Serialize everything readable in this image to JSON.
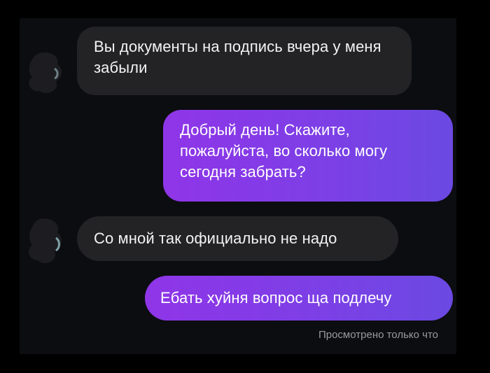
{
  "chat": {
    "messages": [
      {
        "direction": "incoming",
        "text": "Вы документы на подпись вчера у меня забыли"
      },
      {
        "direction": "outgoing",
        "text": "Добрый день! Скажите, пожалуйста, во сколько могу сегодня забрать?"
      },
      {
        "direction": "incoming",
        "text": "Со мной так официально не надо"
      },
      {
        "direction": "outgoing",
        "text": "Ебать хуйня вопрос ща подлечу"
      }
    ],
    "seen_status": "Просмотрено только что"
  },
  "colors": {
    "background": "#0c0d10",
    "incoming_bubble": "#232326",
    "outgoing_bubble_start": "#8f35e8",
    "outgoing_bubble_end": "#6b49e2",
    "status_text": "#9a9aa0"
  },
  "icons": {
    "avatar": "avatar-icon"
  }
}
